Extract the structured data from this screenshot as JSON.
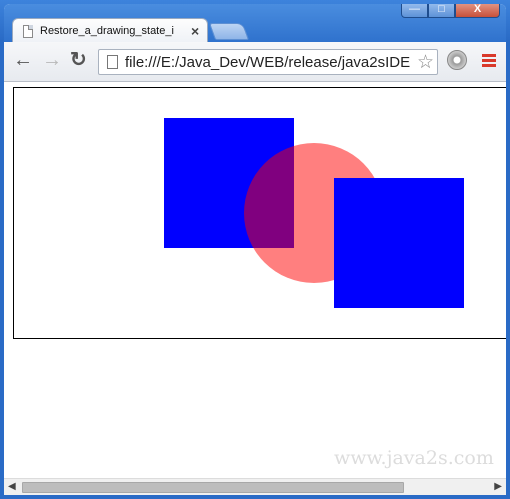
{
  "window": {
    "tab_title": "Restore_a_drawing_state_i",
    "tab_close": "×",
    "controls": {
      "minimize": "—",
      "maximize": "□",
      "close": "X"
    }
  },
  "toolbar": {
    "back": "←",
    "forward": "→",
    "reload": "↻",
    "url": "file:///E:/Java_Dev/WEB/release/java2sIDE",
    "star": "☆"
  },
  "canvas": {
    "shapes": [
      {
        "name": "blue-square-left",
        "color": "#0000ff"
      },
      {
        "name": "red-circle",
        "color": "#ff0000",
        "opacity": 0.5
      },
      {
        "name": "blue-square-right",
        "color": "#0000ff"
      }
    ]
  },
  "watermark": "www.java2s.com",
  "scrollbar": {
    "left_arrow": "◀",
    "right_arrow": "▶"
  }
}
